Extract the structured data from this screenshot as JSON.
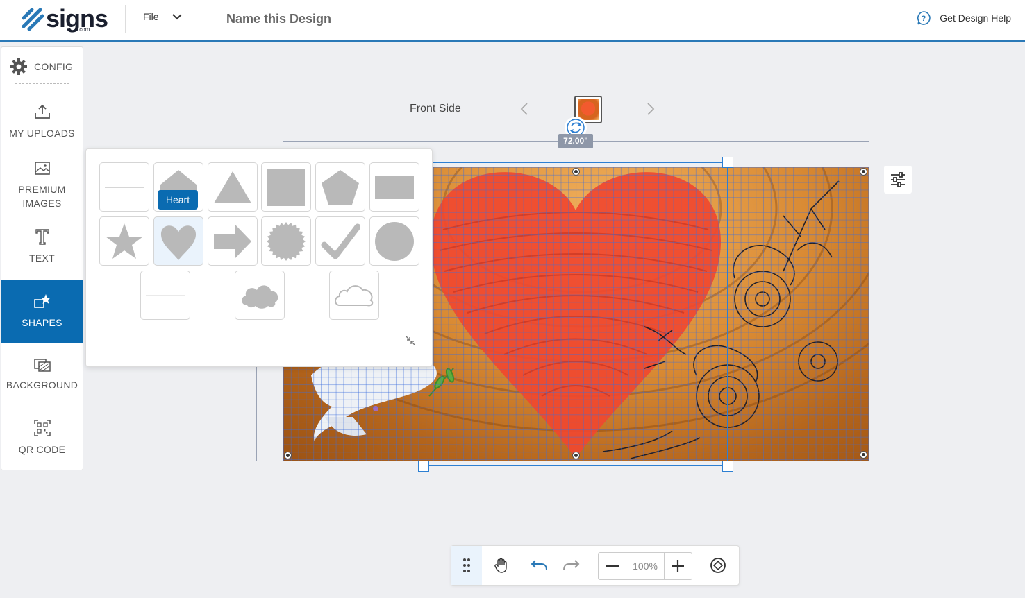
{
  "header": {
    "logo_text": "signs",
    "logo_suffix": ".com",
    "file_label": "File",
    "design_name": "Name this Design",
    "help_label": "Get Design Help"
  },
  "sidebar": {
    "config_label": "CONFIG",
    "items": [
      {
        "label": "MY UPLOADS",
        "icon": "upload-icon"
      },
      {
        "label": "PREMIUM IMAGES",
        "icon": "image-icon"
      },
      {
        "label": "TEXT",
        "icon": "text-icon"
      },
      {
        "label": "SHAPES",
        "icon": "shapes-icon",
        "active": true
      },
      {
        "label": "BACKGROUND",
        "icon": "background-icon"
      },
      {
        "label": "QR CODE",
        "icon": "qr-code-icon"
      }
    ]
  },
  "canvas": {
    "side_label": "Front Side",
    "width_label": "72.00\""
  },
  "shapes_panel": {
    "tooltip": "Heart",
    "shapes": [
      "line",
      "home",
      "triangle",
      "square",
      "pentagon",
      "rectangle",
      "star",
      "heart",
      "arrow",
      "starburst",
      "checkmark",
      "circle",
      "thin-line",
      "cloud-filled",
      "cloud-outline"
    ]
  },
  "toolbar": {
    "zoom": "100%"
  },
  "colors": {
    "accent": "#0a6bb1",
    "shape_gray": "#b9b9b9"
  }
}
